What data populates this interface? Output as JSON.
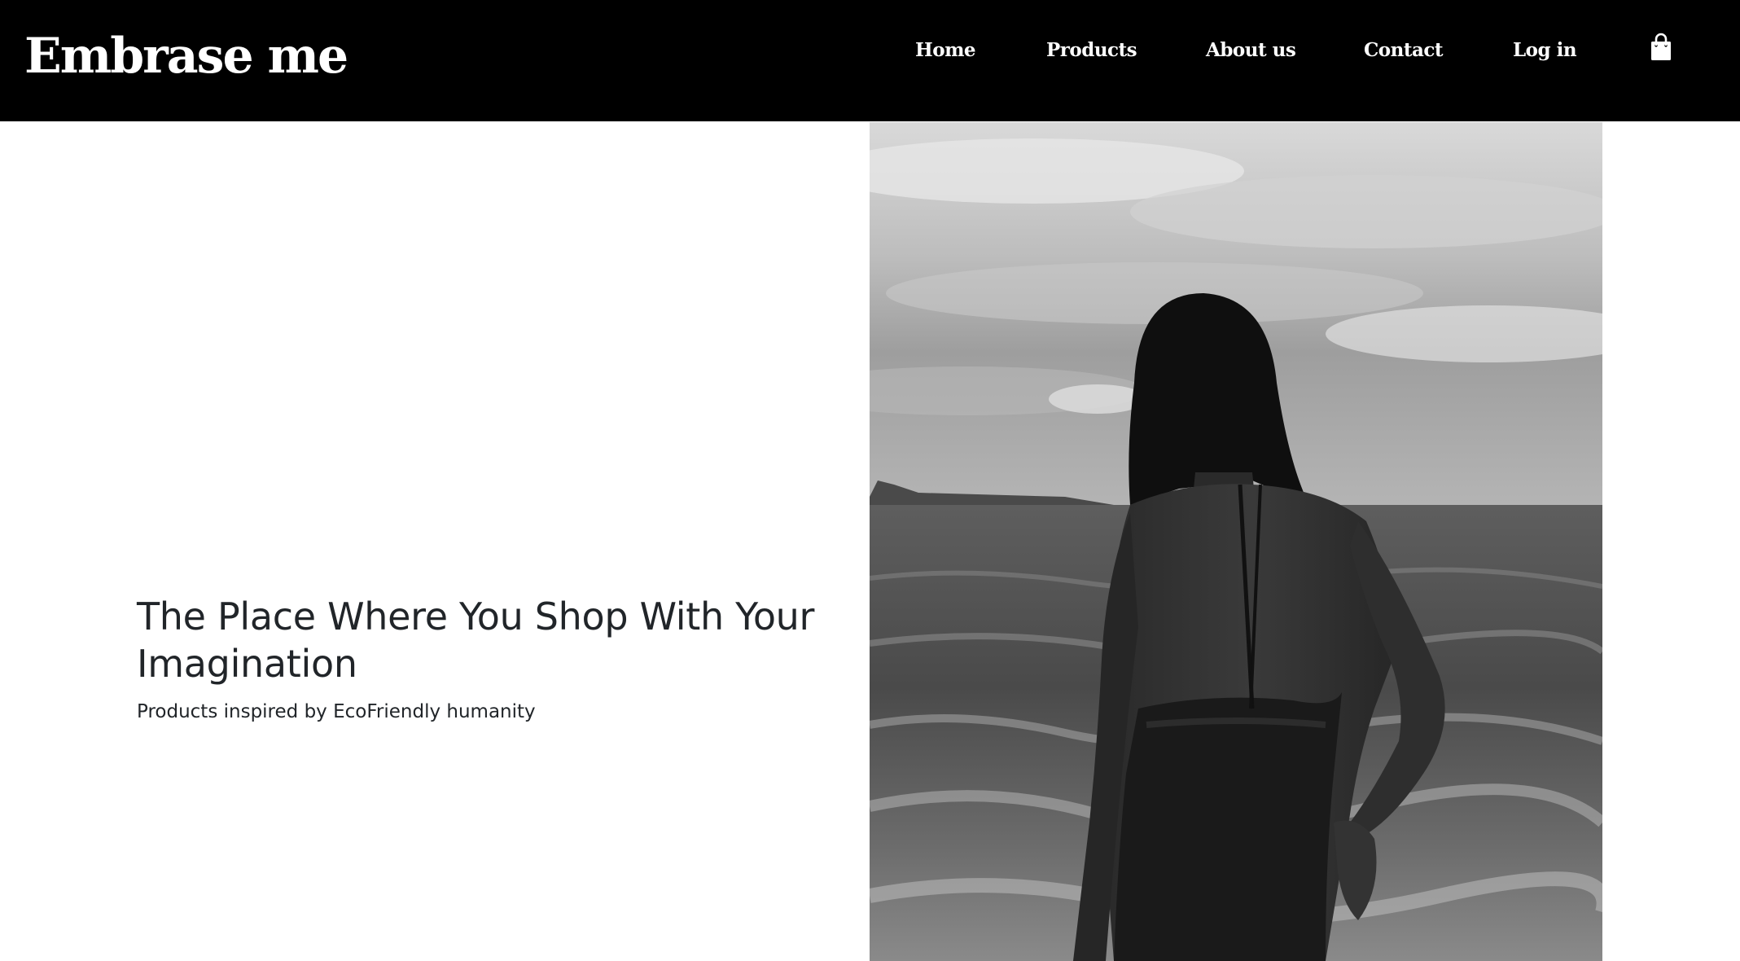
{
  "brand": {
    "name": "Embrase me"
  },
  "nav": {
    "items": [
      {
        "label": "Home"
      },
      {
        "label": "Products"
      },
      {
        "label": "About us"
      },
      {
        "label": "Contact"
      },
      {
        "label": "Log in"
      }
    ],
    "cart_icon": "shopping-bag-icon"
  },
  "hero": {
    "title": "The Place Where You Shop With Your Imagination",
    "subtitle": "Products inspired by EcoFriendly humanity",
    "image_description_icon": "black-and-white-photo"
  },
  "colors": {
    "navbar_bg": "#000000",
    "nav_text": "#ffffff",
    "body_bg": "#ffffff",
    "hero_text": "#212529"
  }
}
